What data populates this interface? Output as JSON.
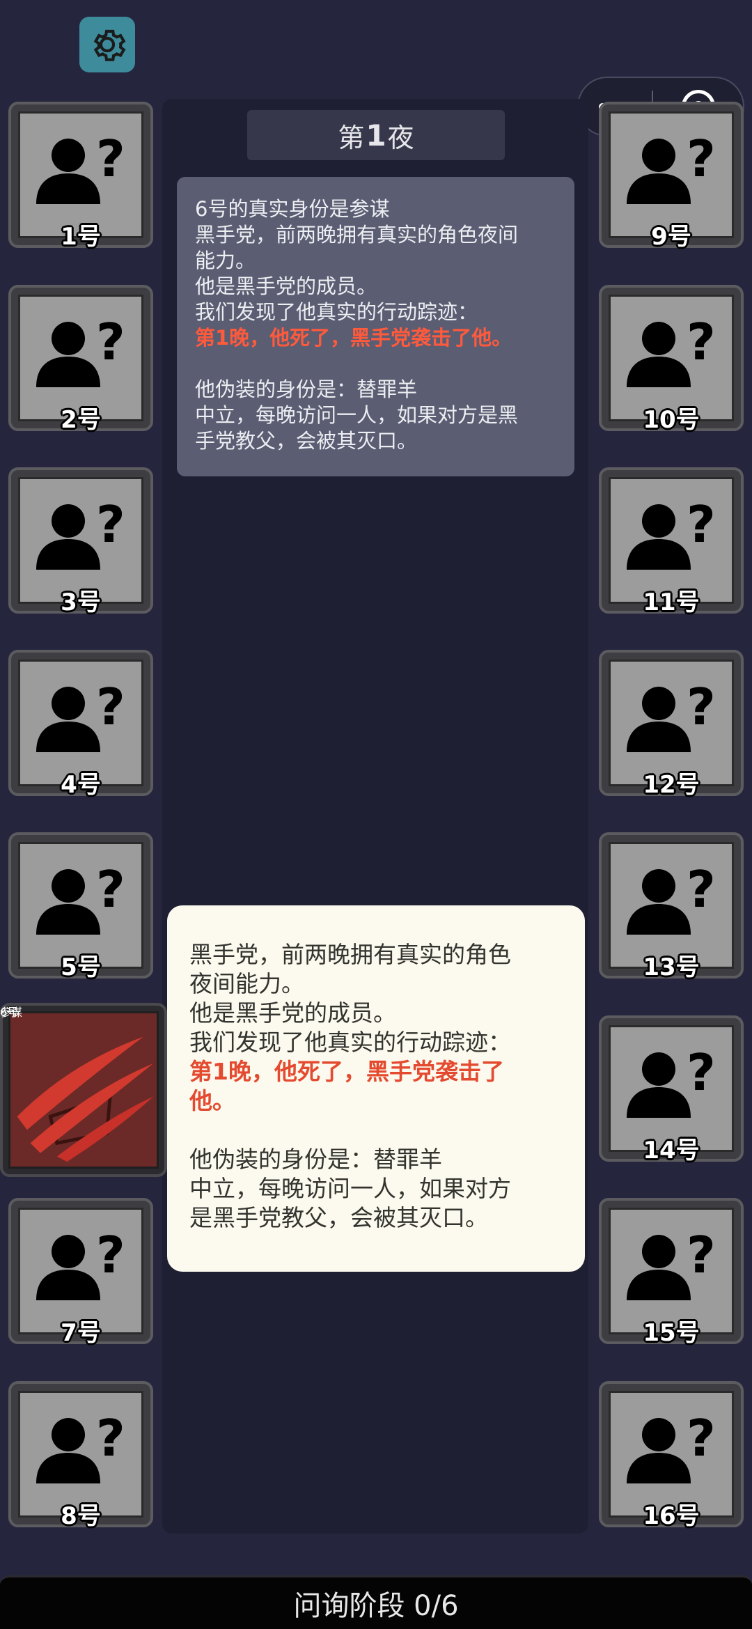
{
  "night": {
    "prefix": "第",
    "number": "1",
    "suffix": "夜"
  },
  "log": {
    "lines": [
      "6号的真实身份是参谋",
      "黑手党，前两晚拥有真实的角色夜间",
      "能力。",
      "他是黑手党的成员。",
      "我们发现了他真实的行动踪迹：",
      "第1晚，他死了，黑手党袭击了他。",
      "",
      "他伪装的身份是：替罪羊",
      "中立，每晚访问一人，如果对方是黑",
      "手党教父，会被其灭口。"
    ]
  },
  "popup": {
    "lines": [
      "黑手党，前两晚拥有真实的角色",
      "夜间能力。",
      "他是黑手党的成员。",
      "我们发现了他真实的行动踪迹：",
      "第1晚，他死了，黑手党袭击了",
      "他。",
      "",
      "他伪装的身份是：替罪羊",
      "中立，每晚访问一人，如果对方",
      "是黑手党教父，会被其灭口。"
    ]
  },
  "seats": {
    "s1": "1号",
    "s2": "2号",
    "s3": "3号",
    "s4": "4号",
    "s5": "5号",
    "s6": "6号",
    "s7": "7号",
    "s8": "8号",
    "s9": "9号",
    "s10": "10号",
    "s11": "11号",
    "s12": "12号",
    "s13": "13号",
    "s14": "14号",
    "s15": "15号",
    "s16": "16号"
  },
  "revealed_role": "参谋",
  "phase": "问询阶段 0/6",
  "icons": {
    "settings": "gear-icon",
    "unknown_player": "unknown-person-icon",
    "claw": "claw-slash-icon",
    "more": "more-dots-icon",
    "close": "target-close-icon"
  },
  "colors": {
    "background": "#25263d",
    "highlight": "#ff5a3c",
    "settings": "#3d8b9b"
  }
}
